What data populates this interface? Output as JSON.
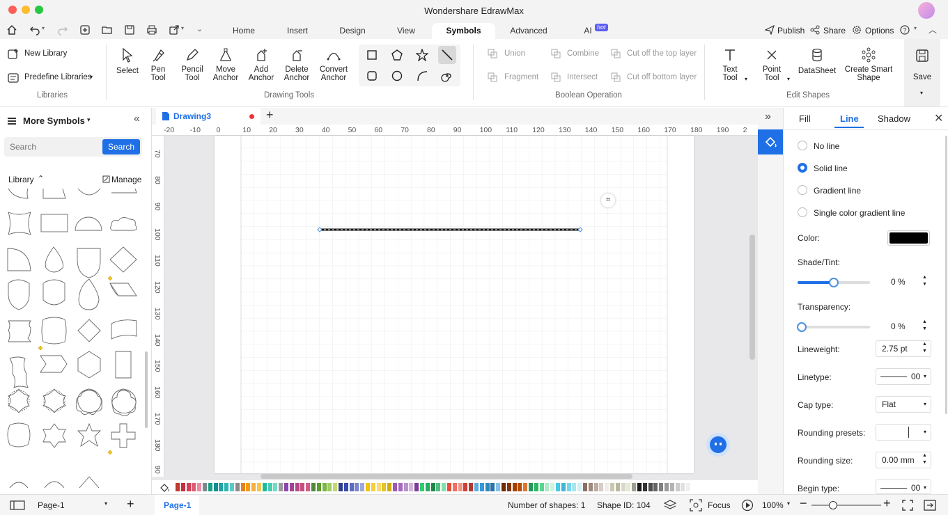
{
  "app": {
    "title": "Wondershare EdrawMax"
  },
  "menu": {
    "tabs": [
      "Home",
      "Insert",
      "Design",
      "View",
      "Symbols",
      "Advanced",
      "AI"
    ],
    "hot_badge": "hot",
    "right": {
      "publish": "Publish",
      "share": "Share",
      "options": "Options"
    }
  },
  "ribbon": {
    "libraries": {
      "new_library": "New Library",
      "predefine": "Predefine Libraries",
      "group": "Libraries"
    },
    "drawing": {
      "select": "Select",
      "pen": [
        "Pen",
        "Tool"
      ],
      "pencil": [
        "Pencil",
        "Tool"
      ],
      "move": [
        "Move",
        "Anchor"
      ],
      "add": [
        "Add",
        "Anchor"
      ],
      "delete": [
        "Delete",
        "Anchor"
      ],
      "convert": [
        "Convert",
        "Anchor"
      ],
      "group": "Drawing Tools"
    },
    "boolean": {
      "union": "Union",
      "combine": "Combine",
      "cut_top": "Cut off the top layer",
      "fragment": "Fragment",
      "intersect": "Intersect",
      "cut_bottom": "Cut off bottom layer",
      "group": "Boolean Operation"
    },
    "edit": {
      "text": [
        "Text",
        "Tool"
      ],
      "point": [
        "Point",
        "Tool"
      ],
      "datasheet": "DataSheet",
      "smart": [
        "Create Smart",
        "Shape"
      ],
      "group": "Edit Shapes"
    },
    "save": "Save"
  },
  "left": {
    "title": "More Symbols",
    "search_placeholder": "Search",
    "search_btn": "Search",
    "library": "Library",
    "manage": "Manage"
  },
  "doc": {
    "tab": "Drawing3",
    "ruler_h": [
      "-20",
      "-10",
      "0",
      "10",
      "20",
      "30",
      "40",
      "50",
      "60",
      "70",
      "80",
      "90",
      "100",
      "110",
      "120",
      "130",
      "140",
      "150",
      "160",
      "170",
      "180",
      "190",
      "2"
    ],
    "ruler_v": [
      "70",
      "80",
      "90",
      "100",
      "110",
      "120",
      "130",
      "140",
      "150",
      "160",
      "170",
      "180",
      "90"
    ]
  },
  "panel": {
    "tabs": [
      "Fill",
      "Line",
      "Shadow"
    ],
    "options": [
      "No line",
      "Solid line",
      "Gradient line",
      "Single color gradient line"
    ],
    "color_label": "Color:",
    "color_value": "#000000",
    "shade_label": "Shade/Tint:",
    "shade_value": "0 %",
    "shade_level": 0.5,
    "transparency_label": "Transparency:",
    "transparency_value": "0 %",
    "transparency_level": 0,
    "lineweight_label": "Lineweight:",
    "lineweight_value": "2.75 pt",
    "linetype_label": "Linetype:",
    "linetype_value": "00",
    "cap_label": "Cap type:",
    "cap_value": "Flat",
    "rounding_presets_label": "Rounding presets:",
    "rounding_size_label": "Rounding size:",
    "rounding_size_value": "0.00 mm",
    "begin_label": "Begin type:",
    "begin_value": "00"
  },
  "status": {
    "page_select": "Page-1",
    "page_tab": "Page-1",
    "shapes": "Number of shapes: 1",
    "shape_id": "Shape ID: 104",
    "focus": "Focus",
    "zoom": "100%",
    "zoom_level": 0.5
  },
  "palette": [
    "#c0392b",
    "#c62f3e",
    "#d2415a",
    "#e05a74",
    "#ee8aa0",
    "#7b8a8b",
    "#16a085",
    "#138d8d",
    "#1fa2a8",
    "#2cb5b5",
    "#5ec8c8",
    "#8a8a8a",
    "#e67e22",
    "#f39c12",
    "#f5b041",
    "#f7c548",
    "#1abc9c",
    "#48c9b0",
    "#76d7c4",
    "#9b9b9b",
    "#8e44ad",
    "#a0439a",
    "#b5478a",
    "#c64f7a",
    "#d35d8a",
    "#4e8a3a",
    "#5a9a2e",
    "#7cb342",
    "#9ccc65",
    "#c5d86d",
    "#2c3e90",
    "#3949ab",
    "#5c6bc0",
    "#7986cb",
    "#9fa8da",
    "#f1c40f",
    "#f4d03f",
    "#f7dc6f",
    "#e6c229",
    "#d4ac0d",
    "#9b59b6",
    "#a569bd",
    "#bb8fce",
    "#d2b4de",
    "#7d3c98",
    "#2ecc71",
    "#27ae60",
    "#1e8449",
    "#52be80",
    "#82e0aa",
    "#e74c3c",
    "#ec7063",
    "#f1948a",
    "#cb4335",
    "#b03a2e",
    "#5dade2",
    "#3498db",
    "#2e86c1",
    "#2874a6",
    "#85c1e9",
    "#6e2c00",
    "#873600",
    "#a04000",
    "#ba4a00",
    "#dc7633",
    "#229954",
    "#28b463",
    "#58d68d",
    "#abebc6",
    "#d4efdf",
    "#48c9e6",
    "#3fb8d8",
    "#76d7ea",
    "#a9e5f0",
    "#d0eef5",
    "#8d6e63",
    "#a1887f",
    "#bcaaa4",
    "#d7ccc8",
    "#efebe9",
    "#c8c8b0",
    "#b8b8a0",
    "#d8d8c8",
    "#e8e8d8",
    "#a0a090",
    "#1a1a1a",
    "#333333",
    "#4d4d4d",
    "#666666",
    "#808080",
    "#999999",
    "#b3b3b3",
    "#cccccc",
    "#e0e0e0",
    "#f0f0f0"
  ]
}
